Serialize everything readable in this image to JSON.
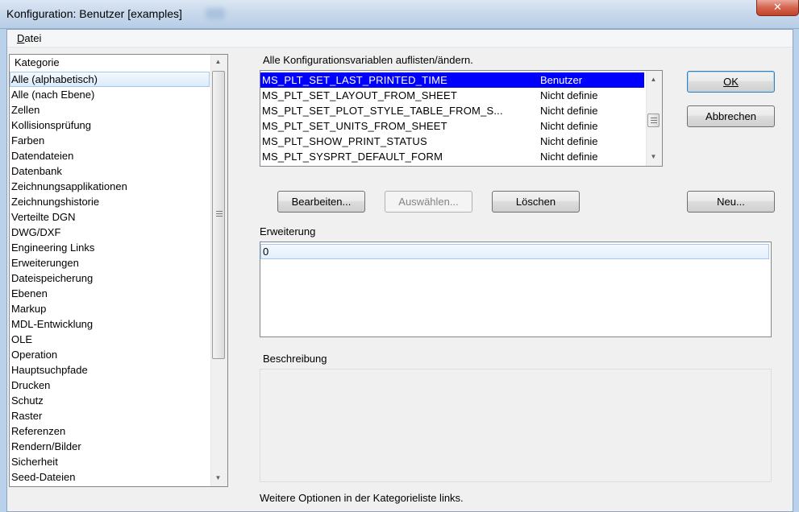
{
  "window": {
    "title": "Konfiguration: Benutzer [examples]",
    "close_glyph": "✕"
  },
  "menu": {
    "datei_prefix": "D",
    "datei_rest": "atei"
  },
  "categories": {
    "header": "Kategorie",
    "items": [
      "Alle (alphabetisch)",
      "Alle (nach Ebene)",
      "Zellen",
      "Kollisionsprüfung",
      "Farben",
      "Datendateien",
      "Datenbank",
      "Zeichnungsapplikationen",
      "Zeichnungshistorie",
      "Verteilte DGN",
      "DWG/DXF",
      "Engineering Links",
      "Erweiterungen",
      "Dateispeicherung",
      "Ebenen",
      "Markup",
      "MDL-Entwicklung",
      "OLE",
      "Operation",
      "Hauptsuchpfade",
      "Drucken",
      "Schutz",
      "Raster",
      "Referenzen",
      "Rendern/Bilder",
      "Sicherheit",
      "Seed-Dateien"
    ],
    "selected_index": 0
  },
  "variables": {
    "label": "Alle Konfigurationsvariablen auflisten/ändern.",
    "rows": [
      {
        "name": "MS_PLT_SET_LAST_PRINTED_TIME",
        "type": "Benutzer"
      },
      {
        "name": "MS_PLT_SET_LAYOUT_FROM_SHEET",
        "type": "Nicht definie"
      },
      {
        "name": "MS_PLT_SET_PLOT_STYLE_TABLE_FROM_S...",
        "type": "Nicht definie"
      },
      {
        "name": "MS_PLT_SET_UNITS_FROM_SHEET",
        "type": "Nicht definie"
      },
      {
        "name": "MS_PLT_SHOW_PRINT_STATUS",
        "type": "Nicht definie"
      },
      {
        "name": "MS_PLT_SYSPRT_DEFAULT_FORM",
        "type": "Nicht definie"
      }
    ],
    "selected_index": 0
  },
  "buttons": {
    "ok": "OK",
    "abbrechen": "Abbrechen",
    "bearbeiten": "Bearbeiten...",
    "auswaehlen": "Auswählen...",
    "loeschen": "Löschen",
    "neu": "Neu..."
  },
  "erweiterung": {
    "label": "Erweiterung",
    "value": "0"
  },
  "beschreibung": {
    "label": "Beschreibung",
    "text": ""
  },
  "footer": "Weitere Optionen in der Kategorieliste links.",
  "icons": {
    "scroll_up": "▲",
    "scroll_down": "▼"
  },
  "colors": {
    "selection": "#0000ff",
    "titlebar": "#c9d9ec",
    "close": "#c7432b"
  }
}
